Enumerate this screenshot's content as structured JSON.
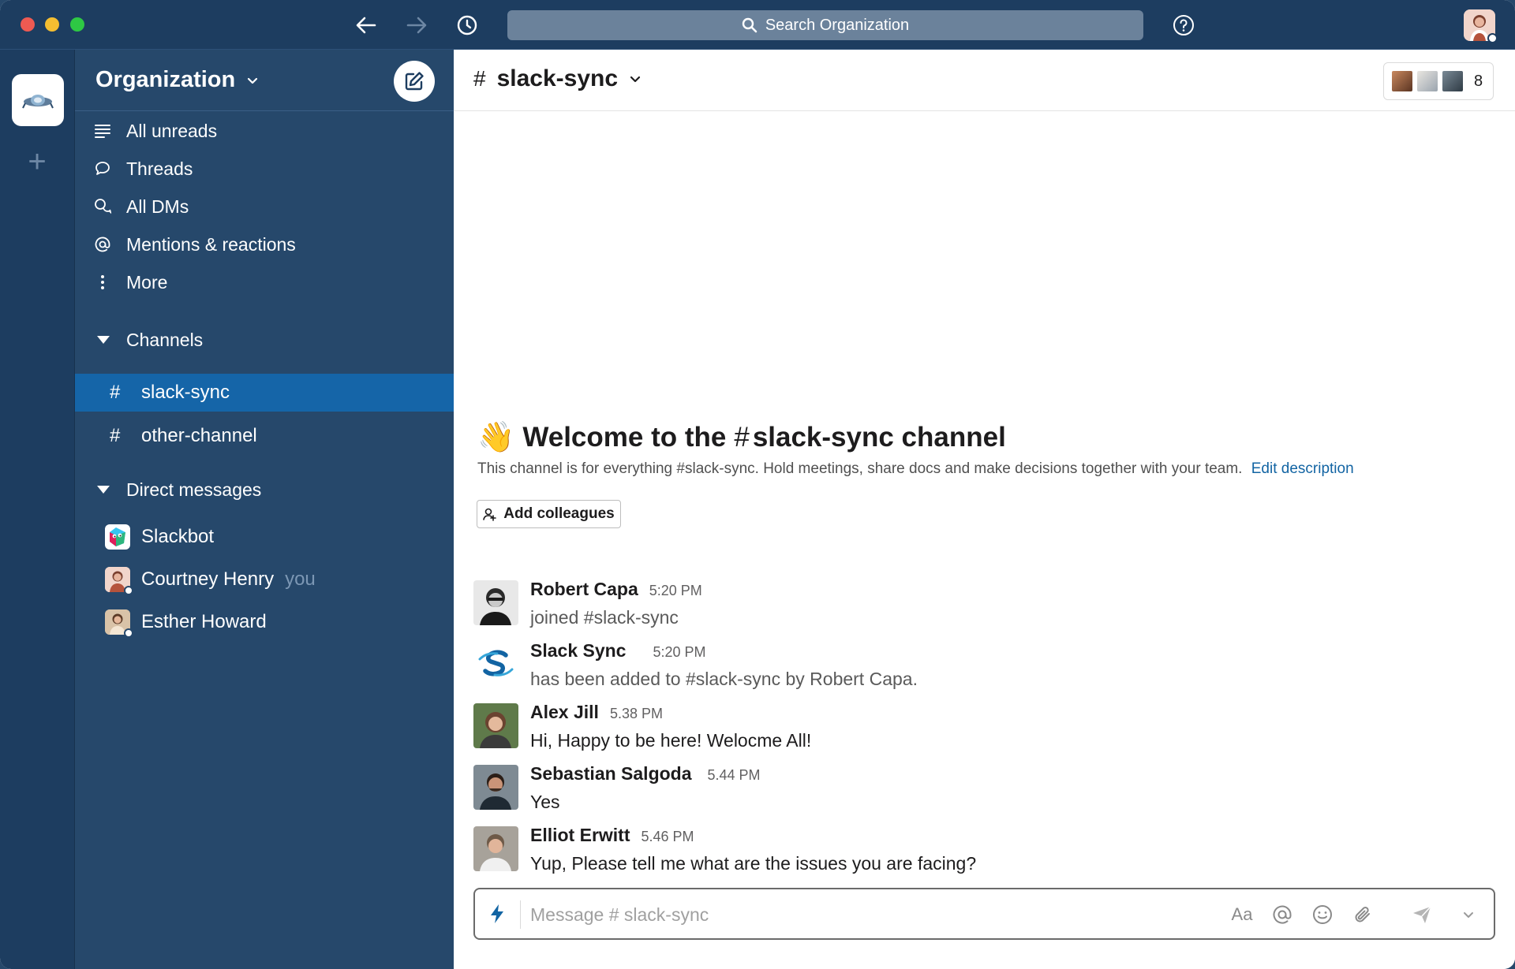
{
  "titlebar": {
    "search_placeholder": "Search Organization",
    "icons": [
      "back-arrow-icon",
      "forward-arrow-icon",
      "history-icon",
      "search-icon",
      "help-icon"
    ]
  },
  "sidebar": {
    "org_name": "Organization",
    "nav": [
      {
        "label": "All unreads",
        "icon": "all-unreads-icon"
      },
      {
        "label": "Threads",
        "icon": "threads-icon"
      },
      {
        "label": "All DMs",
        "icon": "dms-icon"
      },
      {
        "label": "Mentions & reactions",
        "icon": "mention-icon"
      },
      {
        "label": "More",
        "icon": "more-vertical-icon"
      }
    ],
    "channels_label": "Channels",
    "channels": [
      {
        "name": "slack-sync",
        "active": true
      },
      {
        "name": "other-channel",
        "active": false
      }
    ],
    "dms_label": "Direct messages",
    "dms": [
      {
        "name": "Slackbot"
      },
      {
        "name": "Courtney Henry",
        "suffix": "you"
      },
      {
        "name": "Esther Howard"
      }
    ]
  },
  "channel": {
    "hash": "#",
    "name": "slack-sync",
    "member_count": "8"
  },
  "welcome": {
    "emoji": "👋",
    "prefix": "Welcome to the",
    "hash": "#",
    "channel": "slack-sync channel",
    "description": "This channel is for everything #slack-sync. Hold meetings, share docs and make decisions together with your team.",
    "edit_link": "Edit description",
    "add_button": "Add colleagues"
  },
  "messages": [
    {
      "name": "Robert Capa",
      "time": "5:20 PM",
      "text": "joined #slack-sync",
      "system": true
    },
    {
      "name": "Slack Sync",
      "time": "5:20 PM",
      "text": "has been added to #slack-sync by Robert Capa.",
      "system": true
    },
    {
      "name": "Alex Jill",
      "time": "5.38 PM",
      "text": "Hi, Happy to be here! Welocme All!",
      "system": false
    },
    {
      "name": "Sebastian Salgoda",
      "time": "5.44 PM",
      "text": "Yes",
      "system": false
    },
    {
      "name": "Elliot Erwitt",
      "time": "5.46 PM",
      "text": "Yup, Please tell me what are the issues you are facing?",
      "system": false
    }
  ],
  "composer": {
    "placeholder": "Message # slack-sync",
    "format_label": "Aa"
  },
  "colors": {
    "titlebar": "#1d3d60",
    "sidebar": "#26486b",
    "active_channel": "#1565a8",
    "link": "#1264a3"
  }
}
